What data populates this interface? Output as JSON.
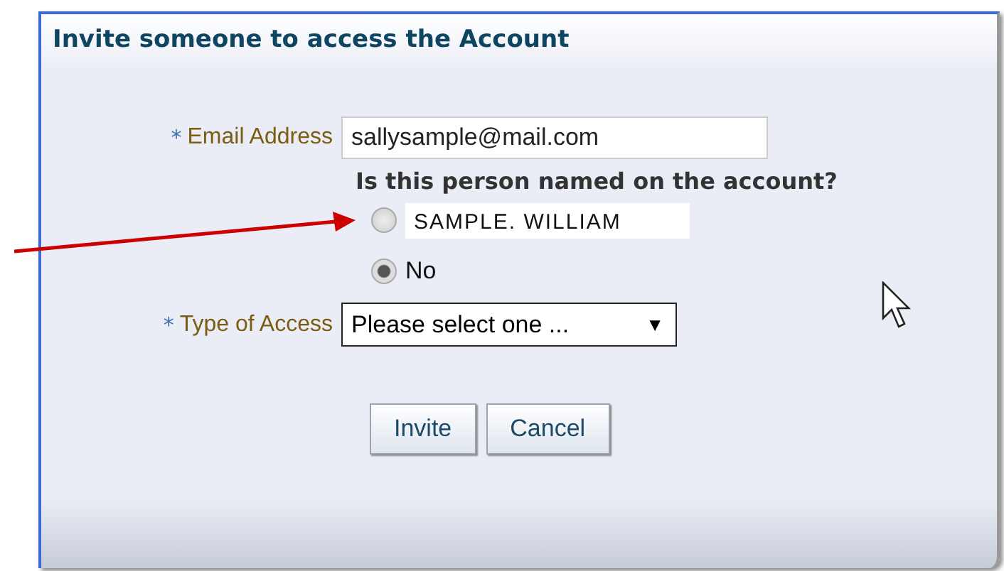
{
  "dialog": {
    "title": "Invite someone to access the Account"
  },
  "email": {
    "required_mark": "*",
    "label": "Email Address",
    "value": "sallysample@mail.com"
  },
  "question": "Is this person named on the account?",
  "options": [
    {
      "label": "SAMPLE. WILLIAM",
      "selected": false,
      "highlighted": true
    },
    {
      "label": "No",
      "selected": true,
      "highlighted": false
    }
  ],
  "access": {
    "required_mark": "*",
    "label": "Type of Access",
    "value": "Please select one ...",
    "caret": "▼"
  },
  "buttons": [
    "Invite",
    "Cancel"
  ]
}
